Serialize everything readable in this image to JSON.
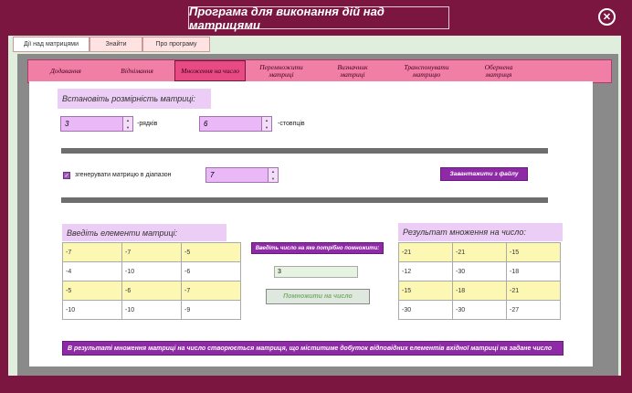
{
  "window": {
    "title": "Програма для виконання дій над матрицями",
    "close_icon": "✕"
  },
  "outer_tabs": [
    {
      "label": "Дії над матрицями",
      "active": true
    },
    {
      "label": "Знайти",
      "active": false
    },
    {
      "label": "Про програму",
      "active": false
    }
  ],
  "inner_tabs": [
    {
      "label": "Додавання",
      "active": false
    },
    {
      "label": "Віднімання",
      "active": false
    },
    {
      "label": "Множення на число",
      "active": true
    },
    {
      "label": "Перемножити матриці",
      "active": false
    },
    {
      "label": "Визначник матриці",
      "active": false
    },
    {
      "label": "Транспонувати матрицю",
      "active": false
    },
    {
      "label": "Обернена матриця",
      "active": false
    }
  ],
  "dimension": {
    "heading": "Встановіть розмірність матриці:",
    "rows_value": "3",
    "rows_label": "-рядків",
    "cols_value": "6",
    "cols_label": "-стовпців"
  },
  "generate": {
    "checked": true,
    "label": "згенерувати матрицю в діапазон",
    "range_value": "7",
    "load_button": "Завантажити з файлу"
  },
  "input_matrix": {
    "heading": "Введіть елементи матриці:",
    "rows": [
      [
        "-7",
        "-7",
        "-5"
      ],
      [
        "-4",
        "-10",
        "-6"
      ],
      [
        "-5",
        "-6",
        "-7"
      ],
      [
        "-10",
        "-10",
        "-9"
      ]
    ]
  },
  "multiply": {
    "prompt": "Введіть число на яке потрібно помножити:",
    "value": "3",
    "button": "Помножити на число"
  },
  "result_matrix": {
    "heading": "Результат множення на число:",
    "rows": [
      [
        "-21",
        "-21",
        "-15"
      ],
      [
        "-12",
        "-30",
        "-18"
      ],
      [
        "-15",
        "-18",
        "-21"
      ],
      [
        "-30",
        "-30",
        "-27"
      ]
    ]
  },
  "footer_note": "В результаті множення матриці на число створюється матриця, що міститиме добуток відповідних елементів вхідної матриці на задане число",
  "colors": {
    "frame": "#7a1640",
    "tab_bar": "#f07ea5",
    "active_tab": "#e84a84",
    "accent_purple": "#8e2aa6",
    "cell_yellow": "#fdf7b4"
  }
}
